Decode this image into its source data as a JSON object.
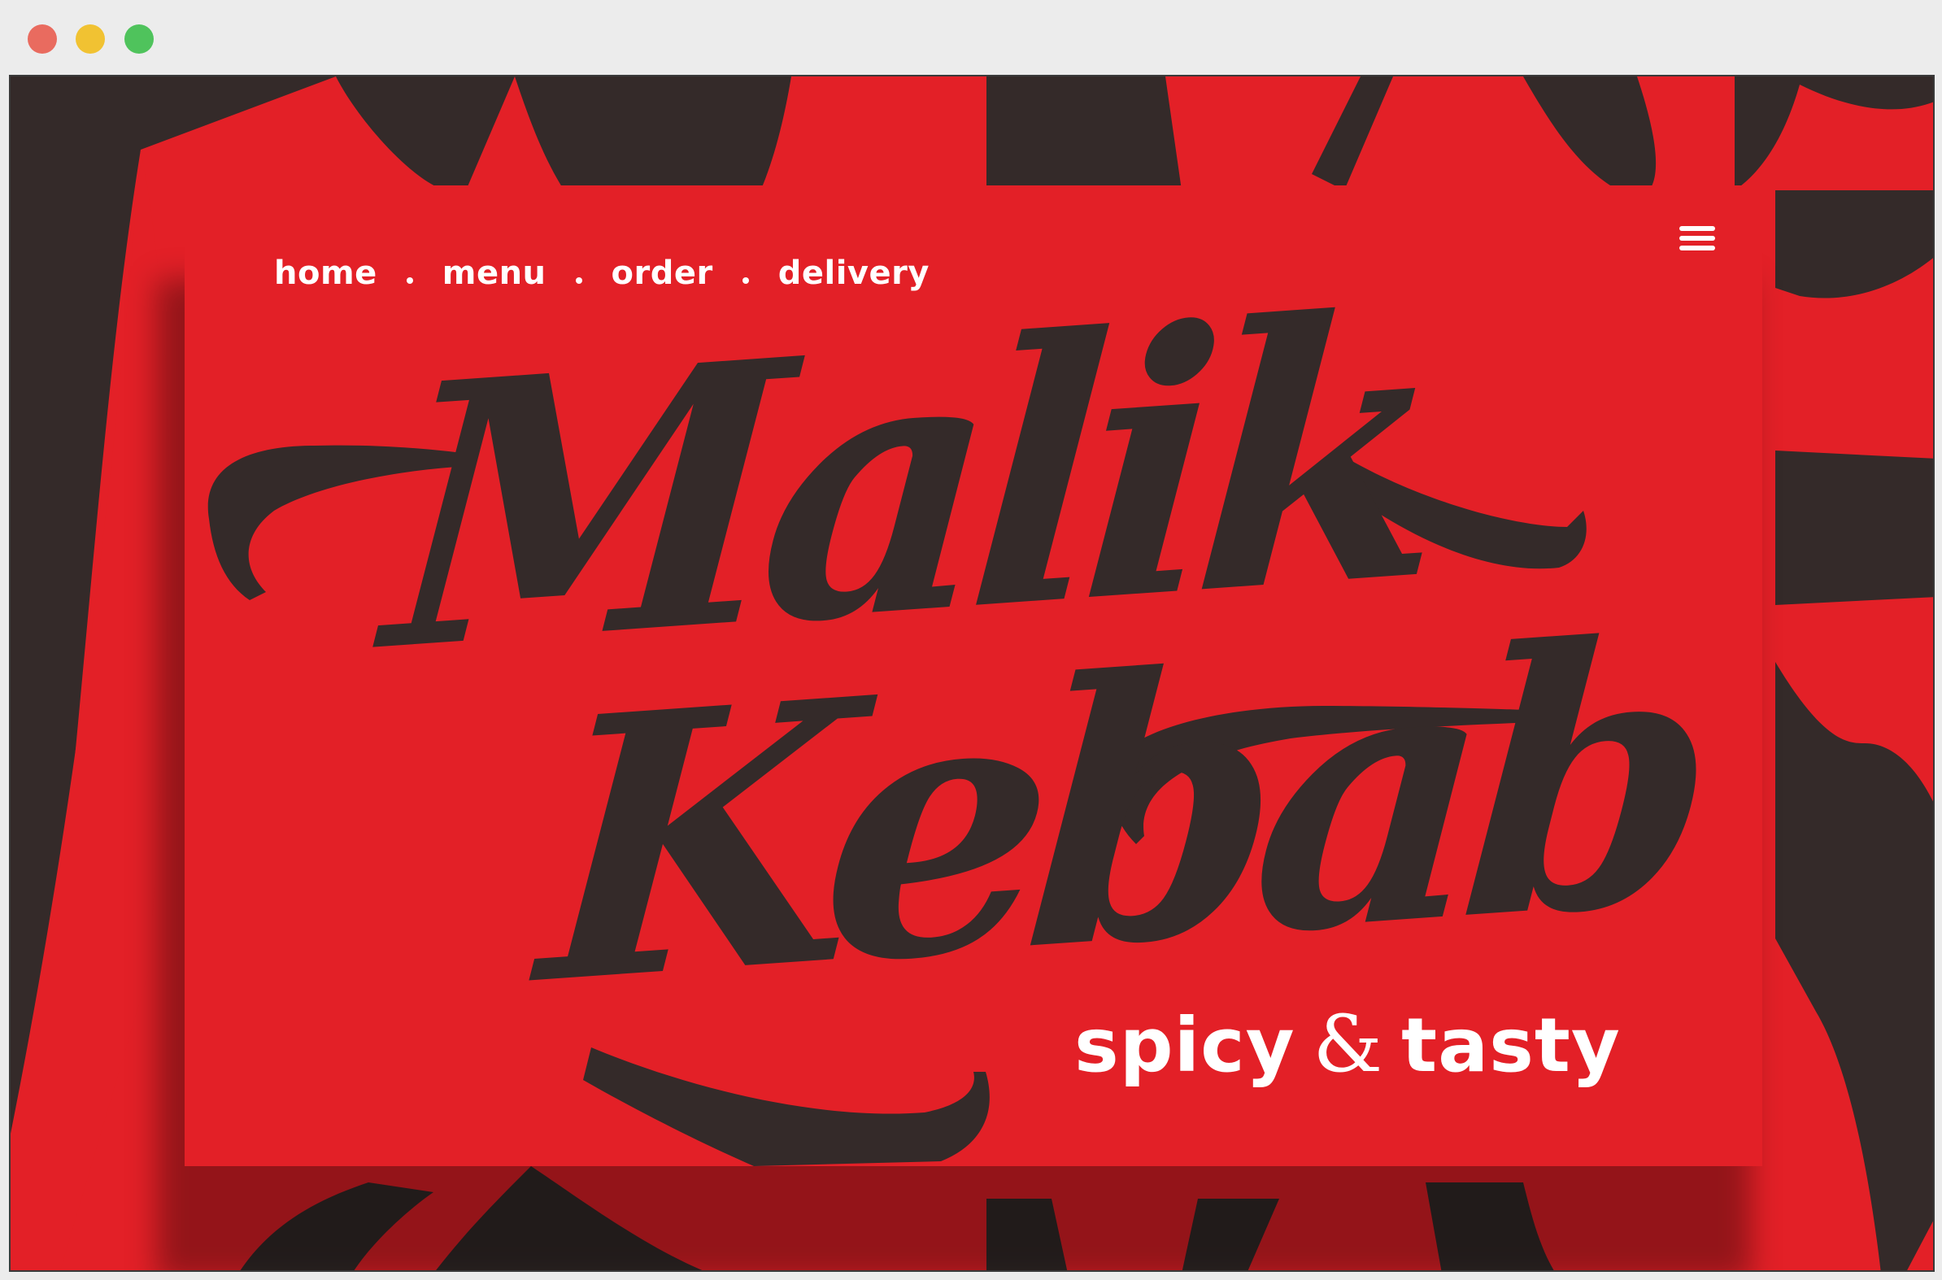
{
  "window": {
    "controls": [
      "close",
      "minimize",
      "maximize"
    ],
    "control_colors": [
      "#e96b5f",
      "#f1c232",
      "#4fc35c"
    ]
  },
  "brand": {
    "name_line1": "Malik",
    "name_line2": "Kebab",
    "tagline_part1": "spicy",
    "tagline_amp": "&",
    "tagline_part2": "tasty"
  },
  "nav": {
    "items": [
      "home",
      "menu",
      "order",
      "delivery"
    ],
    "menu_icon": "hamburger-icon"
  },
  "colors": {
    "primary_red": "#e32027",
    "dark": "#342a29",
    "text_white": "#ffffff"
  }
}
